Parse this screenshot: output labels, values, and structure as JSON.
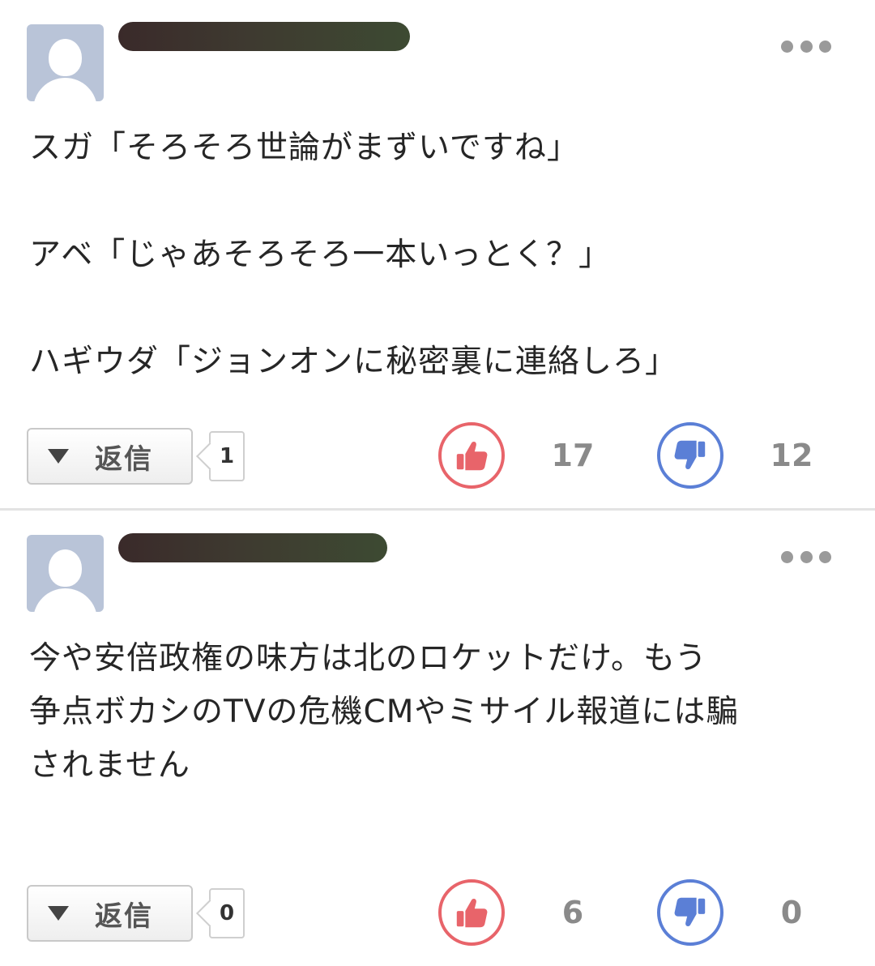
{
  "comments": [
    {
      "lines": [
        "スガ「そろそろ世論がまずいですね」",
        "",
        "アベ「じゃあそろそろ一本いっとく？」",
        "",
        "ハギウダ「ジョンオンに秘密裏に連絡しろ」"
      ],
      "reply_label": "返信",
      "reply_count": "1",
      "likes": "17",
      "dislikes": "12"
    },
    {
      "lines": [
        "今や安倍政権の味方は北のロケットだけ。もう",
        "争点ボカシのTVの危機CMやミサイル報道には騙",
        "されません"
      ],
      "reply_label": "返信",
      "reply_count": "0",
      "likes": "6",
      "dislikes": "0"
    }
  ],
  "colors": {
    "like": "#e8646a",
    "dislike": "#5b7fd6",
    "avatar": "#b9c4d8"
  },
  "icons": {
    "like": "thumbs-up-icon",
    "dislike": "thumbs-down-icon",
    "more": "more-dots-icon",
    "reply": "triangle-down-icon",
    "avatar": "user-silhouette-icon"
  }
}
